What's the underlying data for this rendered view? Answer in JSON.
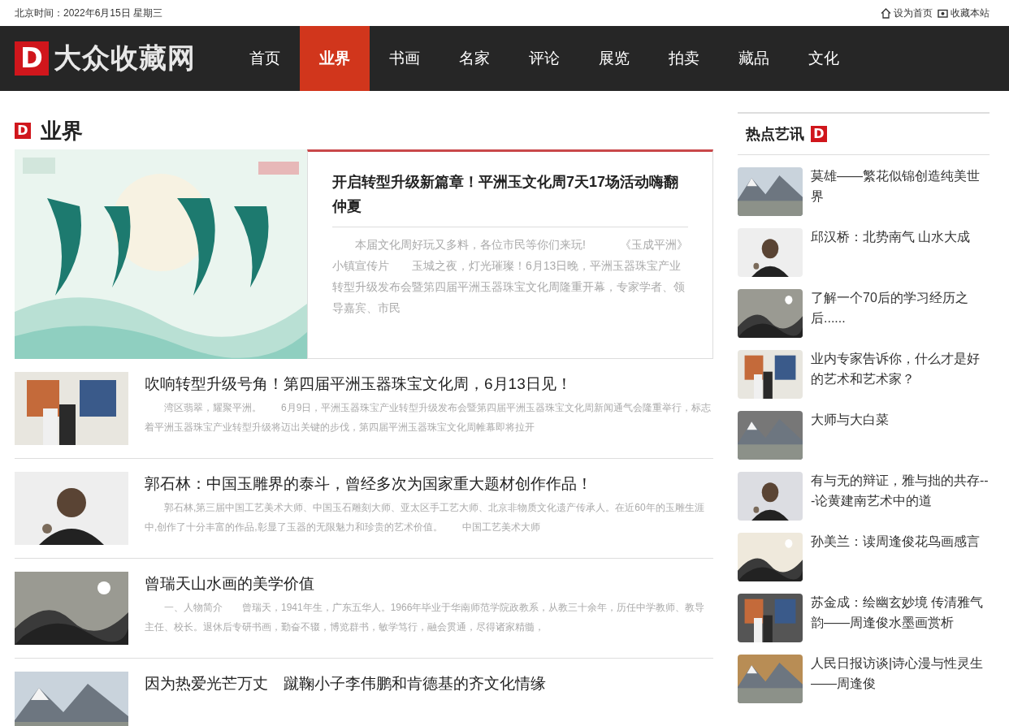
{
  "top_bar": {
    "date": "北京时间：2022年6月15日 星期三",
    "links": [
      {
        "kind": "home",
        "label": "设为首页"
      },
      {
        "kind": "bookmark",
        "label": "收藏本站"
      }
    ]
  },
  "logo": {
    "mark": "D",
    "name": "大众收藏网"
  },
  "nav": [
    {
      "label": "首页",
      "selected": false
    },
    {
      "label": "业界",
      "selected": true
    },
    {
      "label": "书画",
      "selected": false
    },
    {
      "label": "名家",
      "selected": false
    },
    {
      "label": "评论",
      "selected": false
    },
    {
      "label": "展览",
      "selected": false
    },
    {
      "label": "拍卖",
      "selected": false
    },
    {
      "label": "藏品",
      "selected": false
    },
    {
      "label": "文化",
      "selected": false
    }
  ],
  "section": {
    "mark": "D",
    "title": "业界"
  },
  "featured": {
    "title": "开启转型升级新篇章！平洲玉文化周7天17场活动嗨翻仲夏",
    "summary": "　　本届文化周好玩又多料，各位市民等你们来玩!　　　《玉成平洲》小镇宣传片　　玉城之夜，灯光璀璨！6月13日晚，平洲玉器珠宝产业转型升级发布会暨第四届平洲玉器珠宝文化周隆重开幕，专家学者、领导嘉宾、市民"
  },
  "articles": [
    {
      "title": "吹响转型升级号角！第四届平洲玉器珠宝文化周，6月13日见！",
      "summary": "　　湾区翡翠，耀聚平洲。　　6月9日，平洲玉器珠宝产业转型升级发布会暨第四届平洲玉器珠宝文化周新闻通气会隆重举行，标志着平洲玉器珠宝产业转型升级将迈出关键的步伐，第四届平洲玉器珠宝文化周帷幕即将拉开"
    },
    {
      "title": "郭石林：中国玉雕界的泰斗，曾经多次为国家重大题材创作作品！",
      "summary": "　　郭石林,第三届中国工艺美术大师、中国玉石雕刻大师、亚太区手工艺大师、北京非物质文化遗产传承人。在近60年的玉雕生涯中,创作了十分丰富的作品,彰显了玉器的无限魅力和珍贵的艺术价值。　　中国工艺美术大师"
    },
    {
      "title": "曾瑞天山水画的美学价值",
      "summary": "　　一、人物简介　　曾瑞天，1941年生，广东五华人。1966年毕业于华南师范学院政教系，从教三十余年，历任中学教师、教导主任、校长。退休后专研书画，勤奋不辍，博览群书，敏学笃行，融会贯通，尽得诸家精髓，"
    },
    {
      "title": "因为热爱光芒万丈　蹴鞠小子李伟鹏和肯德基的齐文化情缘"
    }
  ],
  "sidebar": {
    "title": "热点艺讯",
    "mark": "D",
    "items": [
      {
        "title": "莫雄——繁花似锦创造纯美世界"
      },
      {
        "title": "邱汉桥：北势南气 山水大成"
      },
      {
        "title": "了解一个70后的学习经历之后......"
      },
      {
        "title": "业内专家告诉你，什么才是好的艺术和艺术家？"
      },
      {
        "title": "大师与大白菜"
      },
      {
        "title": "有与无的辩证，雅与拙的共存---论黄建南艺术中的道"
      },
      {
        "title": "孙美兰：读周逢俊花鸟画感言"
      },
      {
        "title": "苏金成：绘幽玄妙境 传清雅气韵——周逢俊水墨画赏析"
      },
      {
        "title": "人民日报访谈|诗心漫与性灵生——周逢俊"
      }
    ]
  }
}
